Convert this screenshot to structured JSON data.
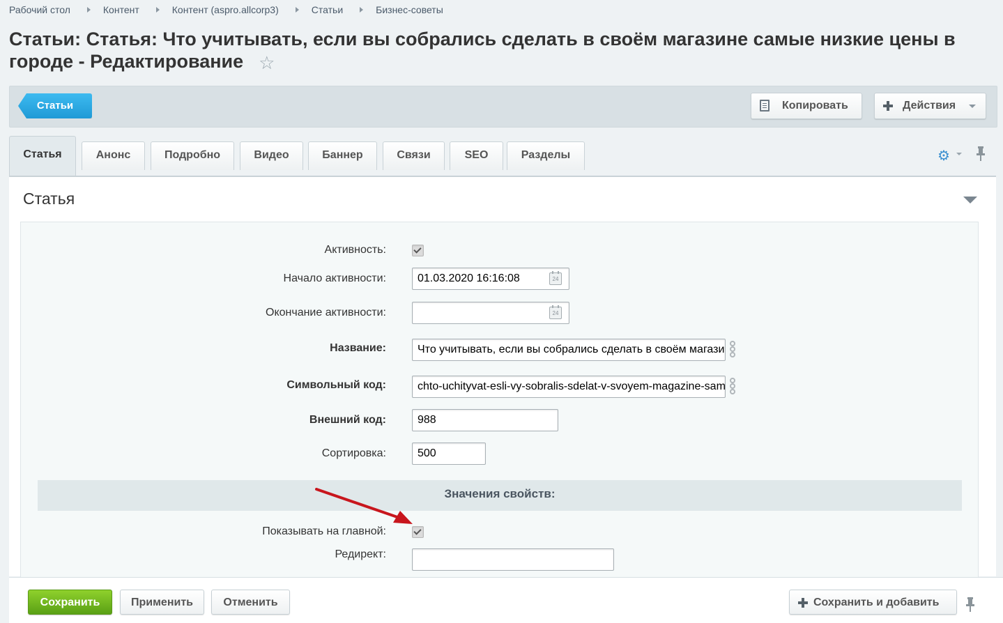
{
  "breadcrumb": [
    "Рабочий стол",
    "Контент",
    "Контент (aspro.allcorp3)",
    "Статьи",
    "Бизнес-советы"
  ],
  "title": "Статьи: Статья: Что учитывать, если вы собрались сделать в своём магазине самые низкие цены в городе - Редактирование",
  "toolbar": {
    "back_label": "Статьи",
    "copy_label": "Копировать",
    "actions_label": "Действия"
  },
  "tabs": [
    "Статья",
    "Анонс",
    "Подробно",
    "Видео",
    "Баннер",
    "Связи",
    "SEO",
    "Разделы"
  ],
  "panel": {
    "title": "Статья",
    "fields": {
      "active_label": "Активность:",
      "active_from_label": "Начало активности:",
      "active_from_value": "01.03.2020 16:16:08",
      "active_to_label": "Окончание активности:",
      "active_to_value": "",
      "name_label": "Название:",
      "name_value": "Что учитывать, если вы собрались сделать в своём магазине самые низкие цены в городе",
      "code_label": "Символьный код:",
      "code_value": "chto-uchityvat-esli-vy-sobralis-sdelat-v-svoyem-magazine-samye-nizkie-tseny-v-gorode",
      "xml_id_label": "Внешний код:",
      "xml_id_value": "988",
      "sort_label": "Сортировка:",
      "sort_value": "500",
      "calendar_day": "24"
    },
    "properties": {
      "header": "Значения свойств:",
      "show_on_main_label": "Показывать на главной:",
      "redirect_label": "Редирект:",
      "redirect_value": ""
    }
  },
  "footer": {
    "save_label": "Сохранить",
    "apply_label": "Применить",
    "cancel_label": "Отменить",
    "save_add_label": "Сохранить и добавить"
  },
  "colors": {
    "accent_blue": "#1f9ad6",
    "save_green": "#6cb41c",
    "annotation_red": "#c8161d"
  }
}
